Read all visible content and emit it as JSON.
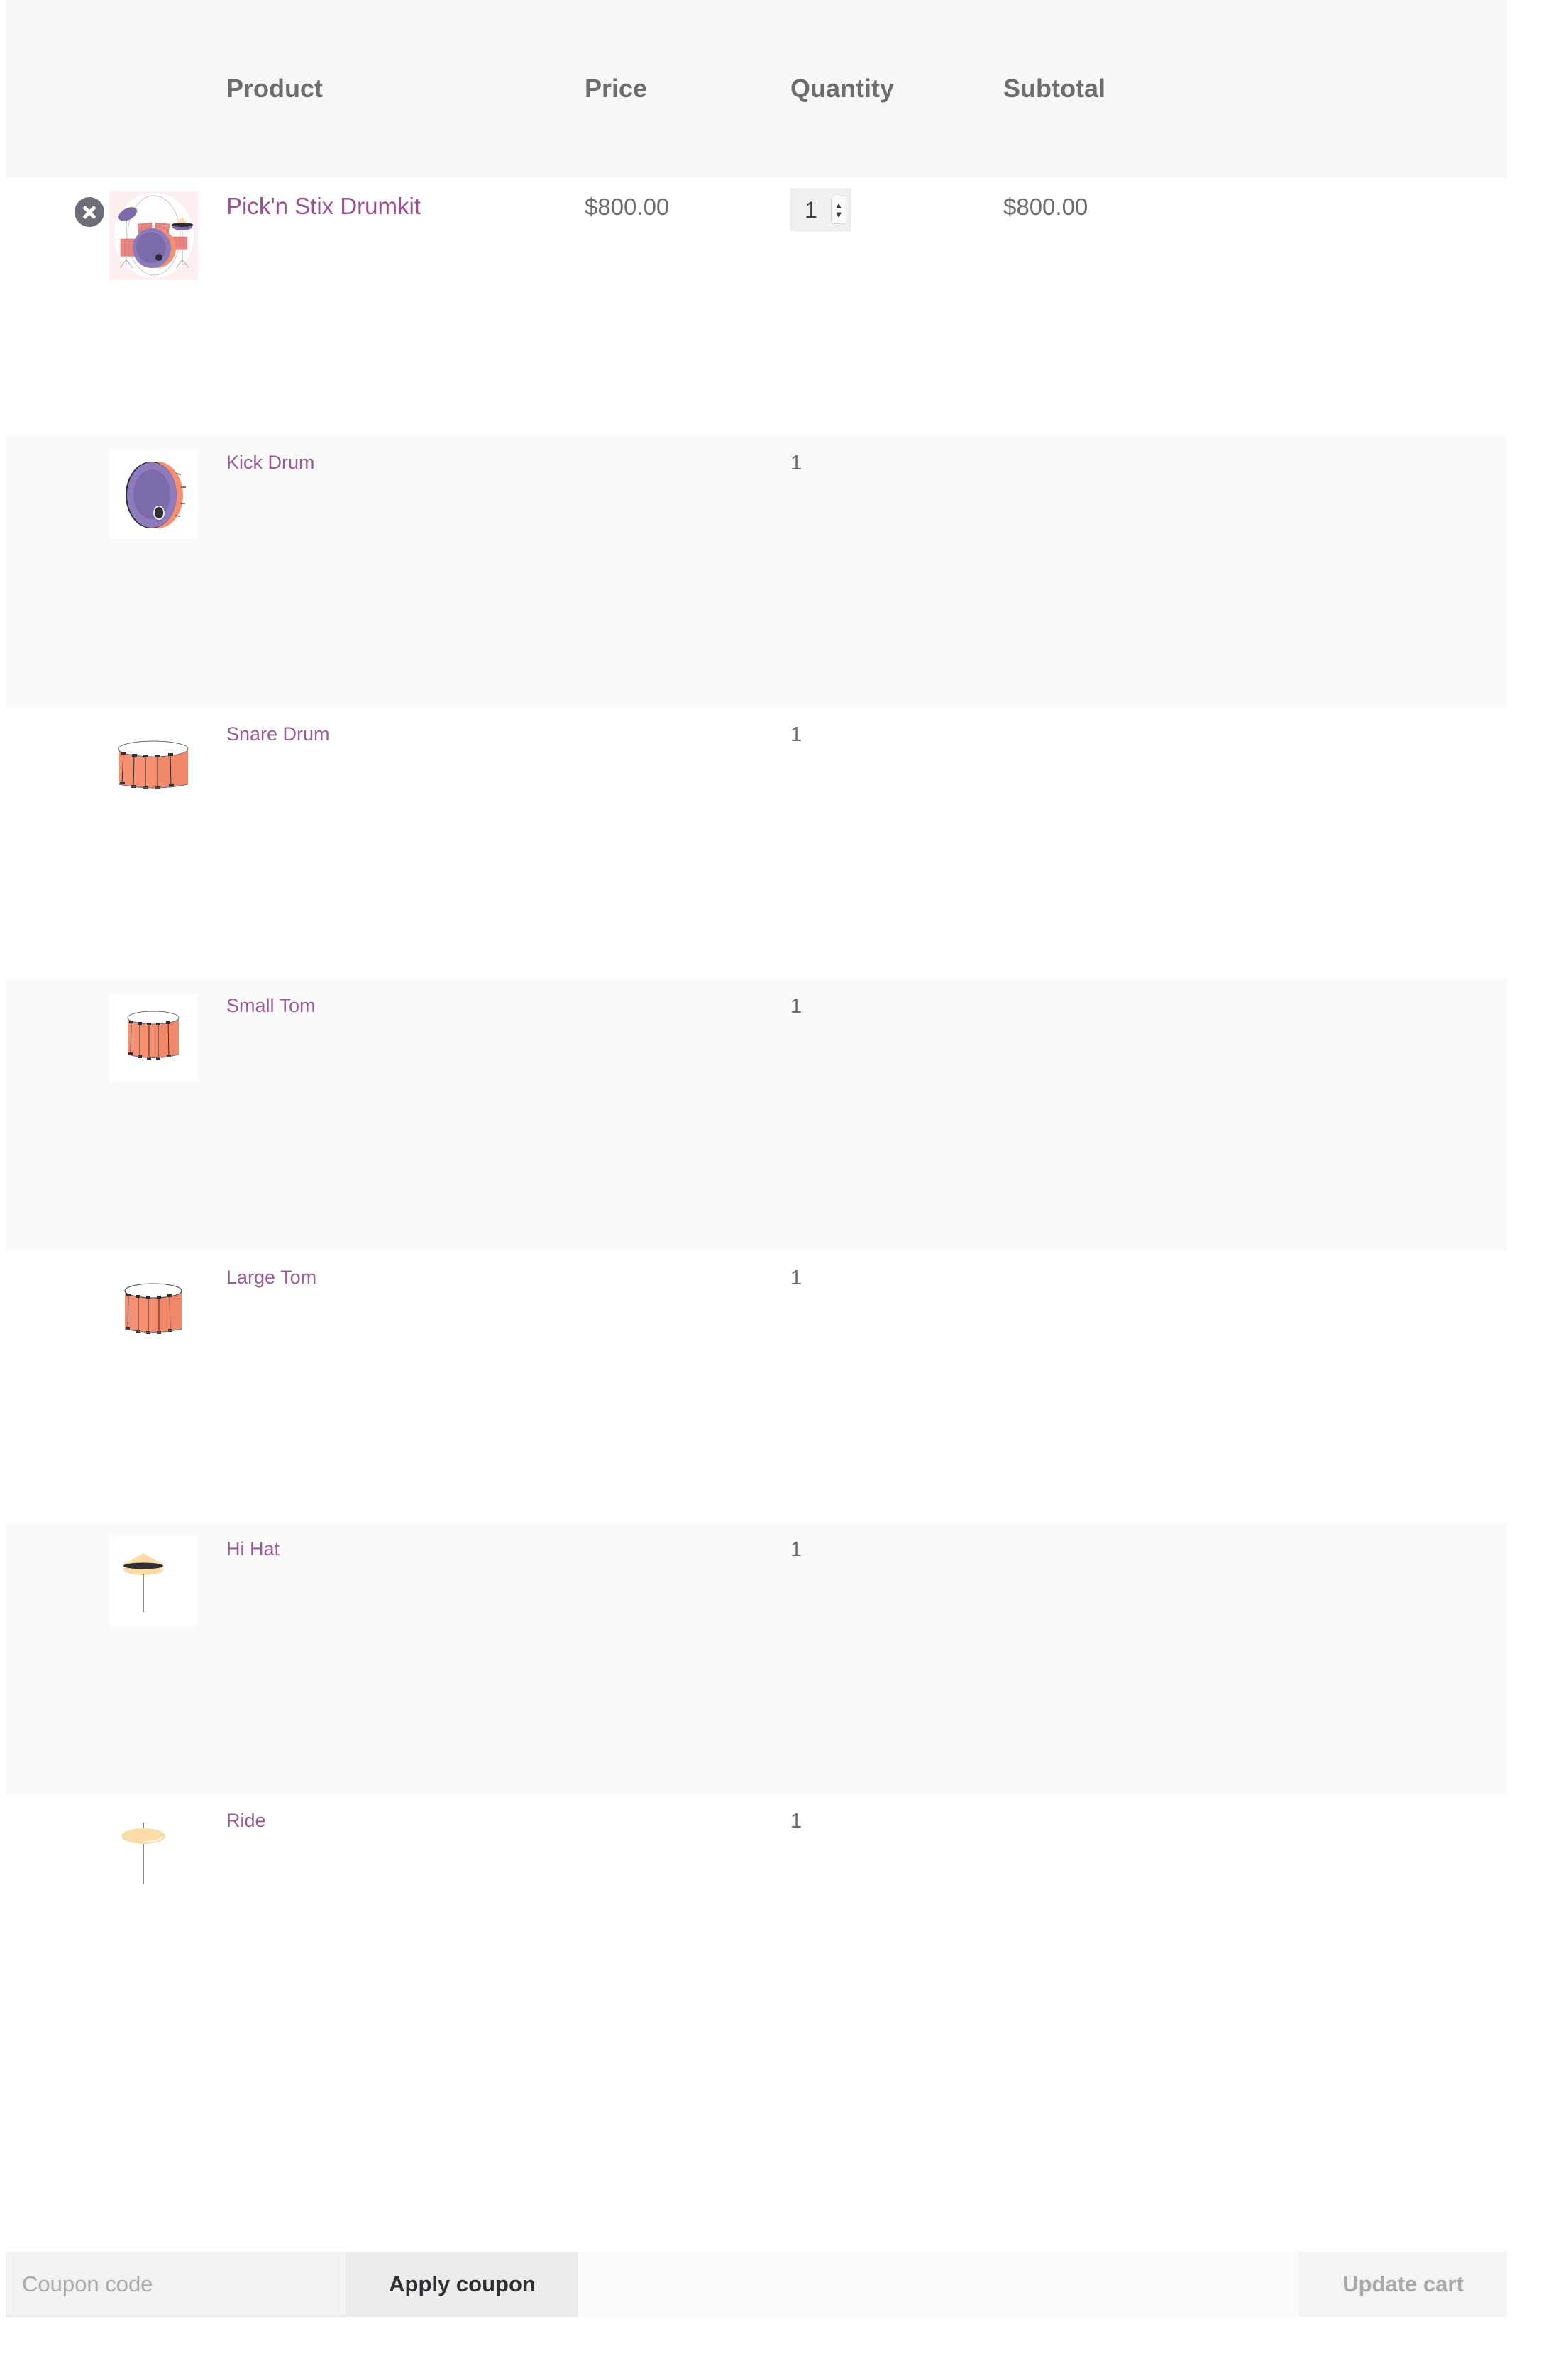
{
  "table": {
    "columns": [
      {
        "key": "remove",
        "label": ""
      },
      {
        "key": "thumb",
        "label": ""
      },
      {
        "key": "product",
        "label": "Product"
      },
      {
        "key": "price",
        "label": "Price"
      },
      {
        "key": "quantity",
        "label": "Quantity"
      },
      {
        "key": "subtotal",
        "label": "Subtotal"
      }
    ],
    "rows": [
      {
        "remove_icon": "remove-item-icon",
        "thumb_icon": "drumkit-thumbnail",
        "name": "Pick'n Stix Drumkit",
        "price": "$800.00",
        "quantity": "1",
        "quantity_type": "stepper",
        "subtotal": "$800.00",
        "is_bundle_parent": true
      },
      {
        "remove_icon": "",
        "thumb_icon": "kick-drum-thumbnail",
        "name": "Kick Drum",
        "price": "",
        "quantity": "1",
        "quantity_type": "text",
        "subtotal": "",
        "is_bundle_parent": false
      },
      {
        "remove_icon": "",
        "thumb_icon": "snare-drum-thumbnail",
        "name": "Snare Drum",
        "price": "",
        "quantity": "1",
        "quantity_type": "text",
        "subtotal": "",
        "is_bundle_parent": false
      },
      {
        "remove_icon": "",
        "thumb_icon": "small-tom-thumbnail",
        "name": "Small Tom",
        "price": "",
        "quantity": "1",
        "quantity_type": "text",
        "subtotal": "",
        "is_bundle_parent": false
      },
      {
        "remove_icon": "",
        "thumb_icon": "large-tom-thumbnail",
        "name": "Large Tom",
        "price": "",
        "quantity": "1",
        "quantity_type": "text",
        "subtotal": "",
        "is_bundle_parent": false
      },
      {
        "remove_icon": "",
        "thumb_icon": "hi-hat-thumbnail",
        "name": "Hi Hat",
        "price": "",
        "quantity": "1",
        "quantity_type": "text",
        "subtotal": "",
        "is_bundle_parent": false
      },
      {
        "remove_icon": "",
        "thumb_icon": "ride-cymbal-thumbnail",
        "name": "Ride",
        "price": "",
        "quantity": "1",
        "quantity_type": "text",
        "subtotal": "",
        "is_bundle_parent": false
      }
    ]
  },
  "coupon": {
    "placeholder": "Coupon code",
    "value": "",
    "apply_label": "Apply coupon",
    "update_label": "Update cart",
    "update_enabled": false
  },
  "colors": {
    "link": "#9a5d93",
    "header_bg": "#f7f7f7",
    "row_alt_bg": "#fafafa",
    "row_bg": "#ffffff",
    "text_muted": "#6d6d6d",
    "remove_circle": "#6d6d78",
    "drum_salmon": "#f79070",
    "drum_purple": "#7c6bab",
    "cymbal_cream": "#fbdba6",
    "thumb_pink_bg": "#fdeef0"
  }
}
